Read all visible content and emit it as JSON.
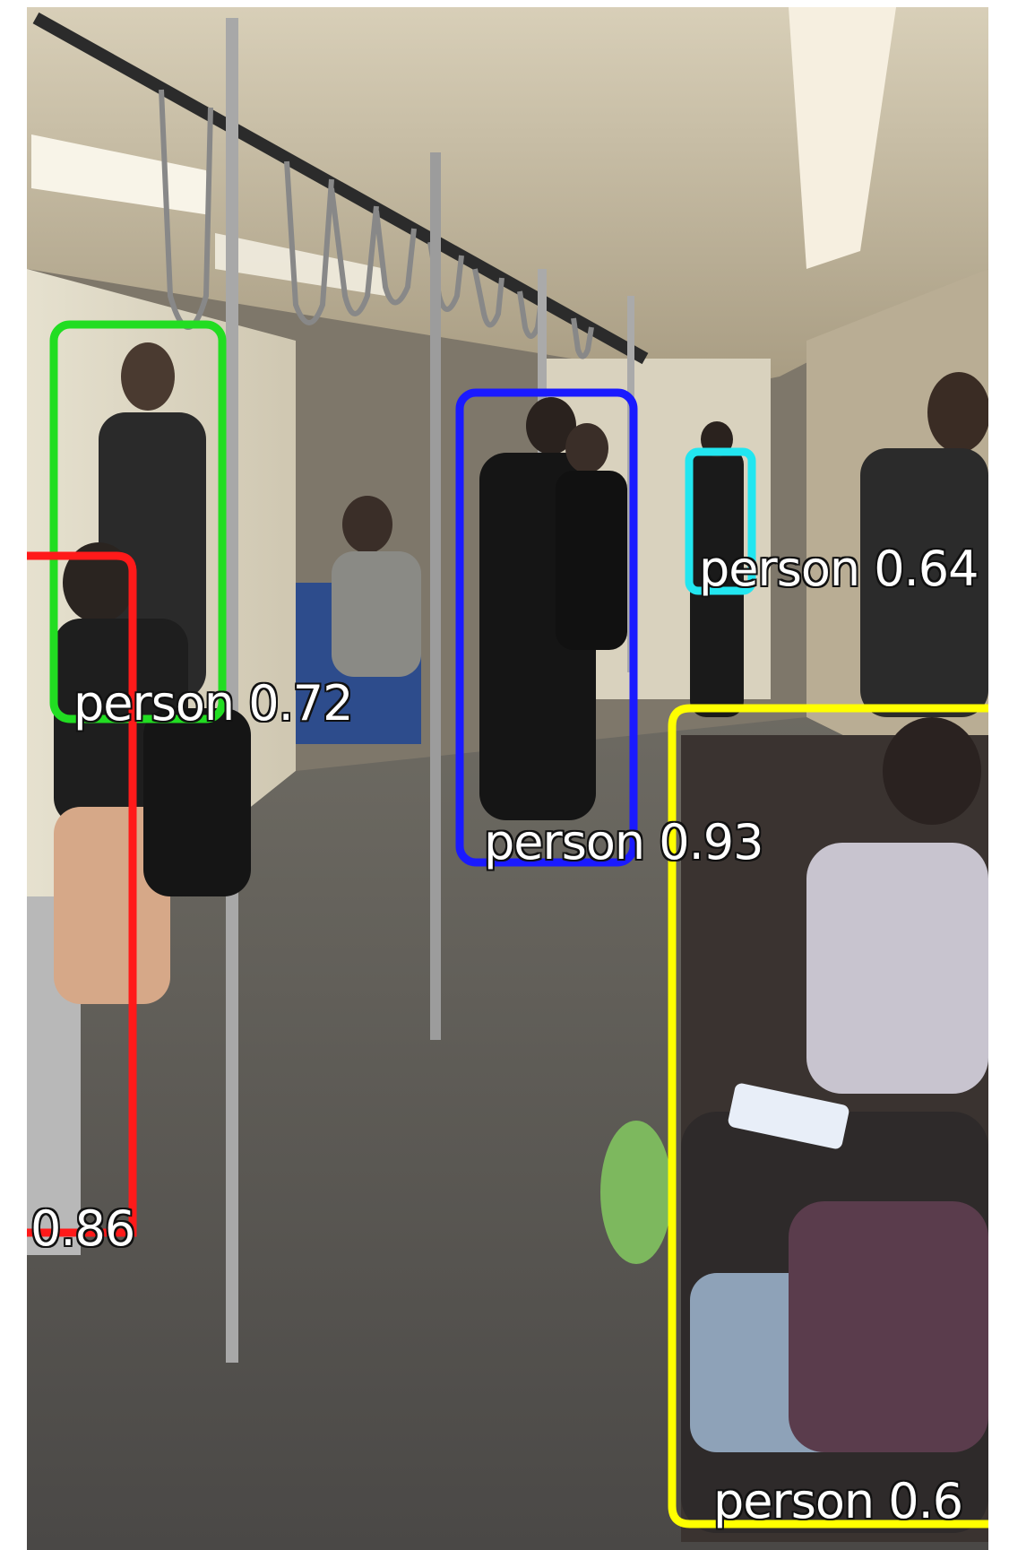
{
  "detections": [
    {
      "label": "person 0.72",
      "color": "#22dd22",
      "object": "standing-passenger-left"
    },
    {
      "label": "0.86",
      "color": "#ff1a1a",
      "object": "seated-passenger-left"
    },
    {
      "label": "person 0.93",
      "color": "#1a1aff",
      "object": "standing-passenger-center"
    },
    {
      "label": "person 0.64",
      "color": "#22e6f0",
      "object": "distant-passenger"
    },
    {
      "label": "person 0.6",
      "color": "#ffff00",
      "object": "seated-passenger-right"
    }
  ]
}
